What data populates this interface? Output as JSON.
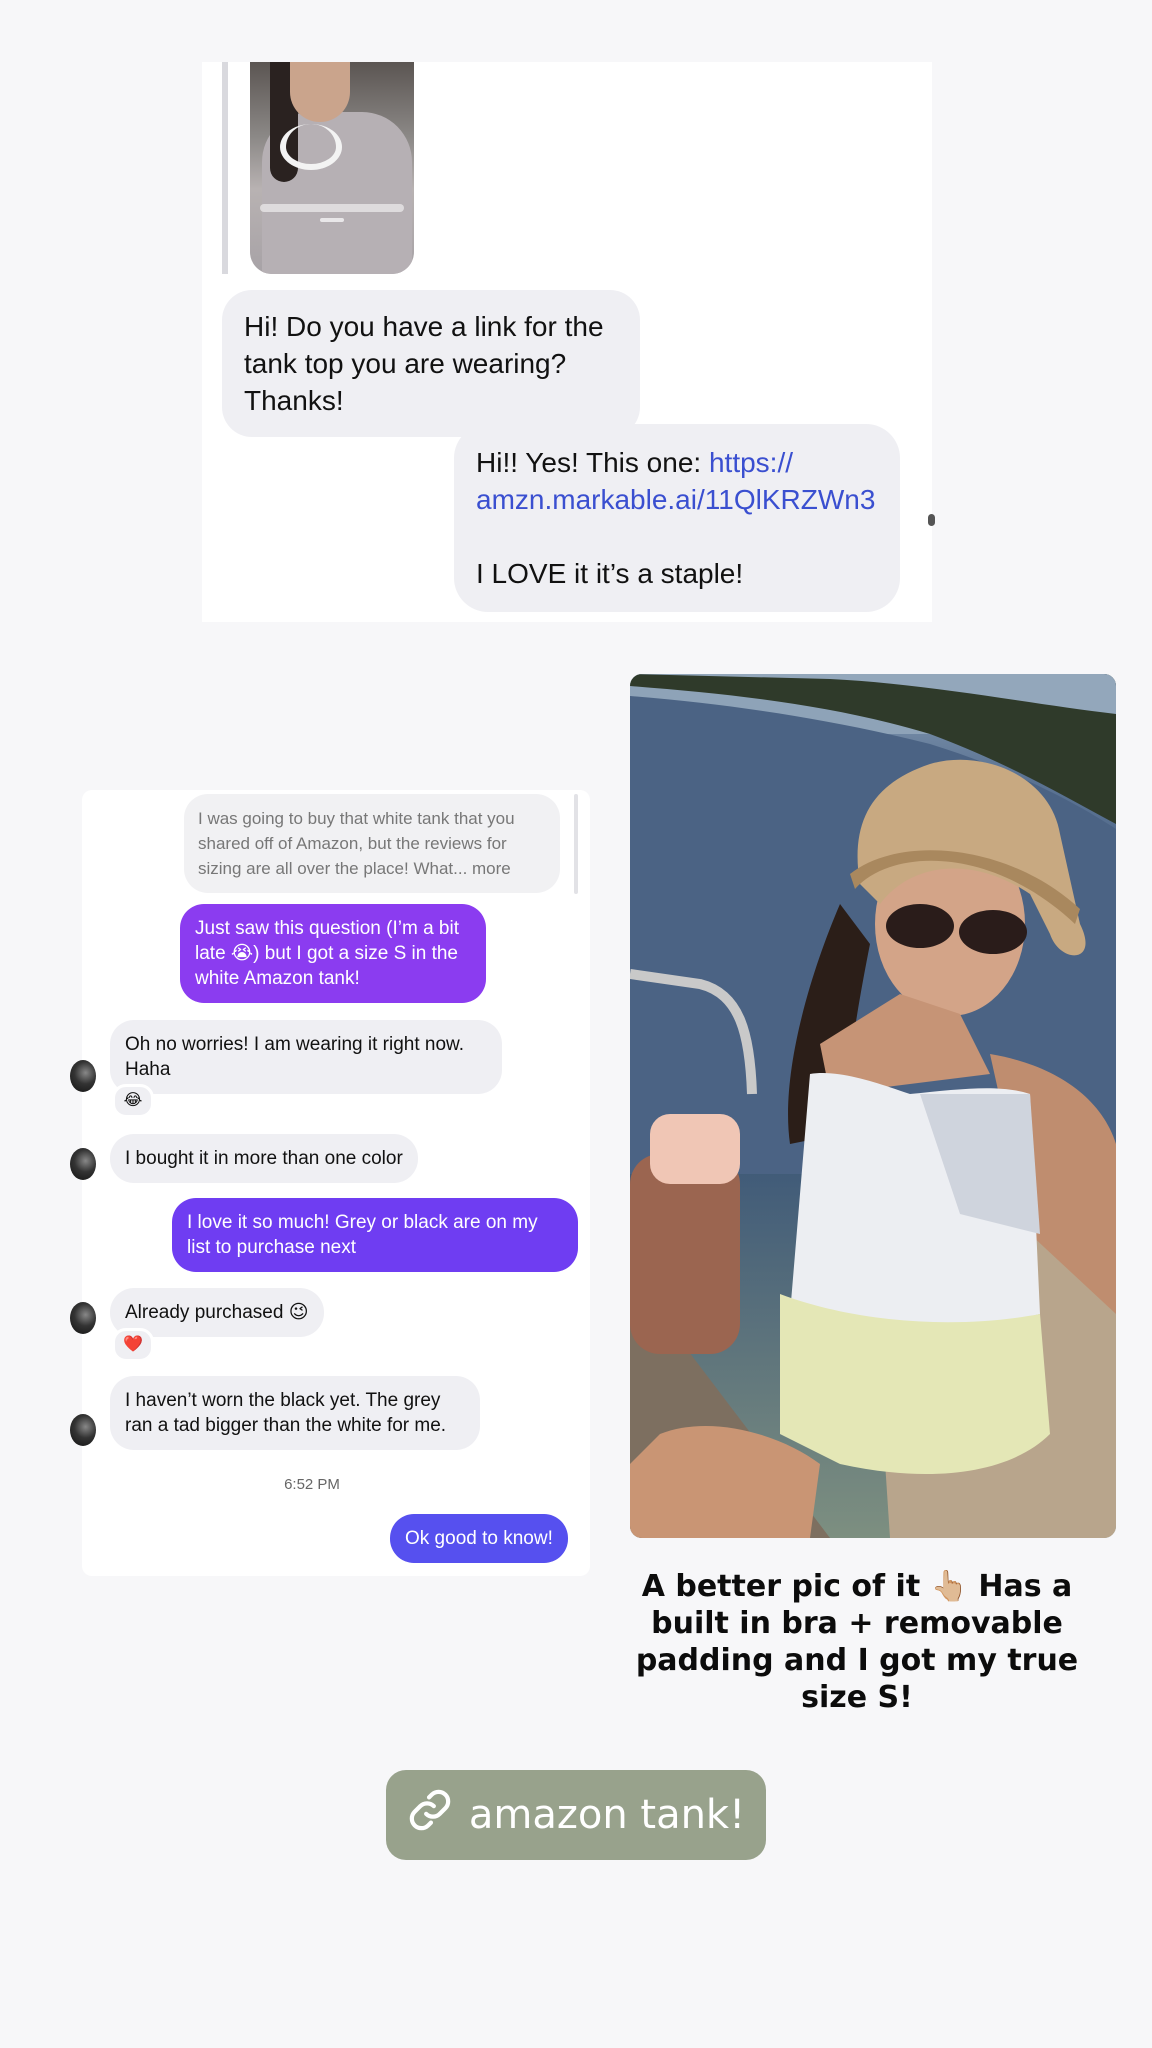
{
  "top_chat": {
    "incoming": "Hi! Do you have a link for the tank top you are wearing? Thanks!",
    "outgoing_prefix": "Hi!! Yes! This one: ",
    "outgoing_link_line1": "https://",
    "outgoing_link_line2": "amzn.markable.ai/11QlKRZWn3",
    "outgoing_suffix": "I LOVE it it’s a staple!"
  },
  "dm_screenshot": {
    "quoted_message": "I was going to buy that white tank that you shared off of Amazon, but the reviews for sizing are all over the place! What... more",
    "messages": [
      {
        "side": "out",
        "text": "Just saw this question (I’m a bit late 😭) but I got a size S in the white Amazon tank!",
        "color": "#8b3cf0"
      },
      {
        "side": "in",
        "text": "Oh no worries! I am wearing it right now. Haha",
        "reaction": "😂"
      },
      {
        "side": "in",
        "text": "I bought it in more than one color"
      },
      {
        "side": "out",
        "text": "I love it so much! Grey or black are on my list to purchase next",
        "color": "#6f3df2"
      },
      {
        "side": "in",
        "text": "Already purchased 😉",
        "reaction": "❤️"
      },
      {
        "side": "in",
        "text": "I haven’t worn the black yet. The grey ran a tad bigger than the white for me."
      },
      {
        "side": "out",
        "text": "Ok good to know!",
        "color": "#5650ef"
      }
    ],
    "timestamp": "6:52 PM"
  },
  "caption": "A better pic of it 👆🏼 Has a built in bra + removable padding and I got my true size S!",
  "link_sticker": {
    "label": "amazon tank!",
    "icon": "link-icon",
    "background": "#98a28c"
  }
}
